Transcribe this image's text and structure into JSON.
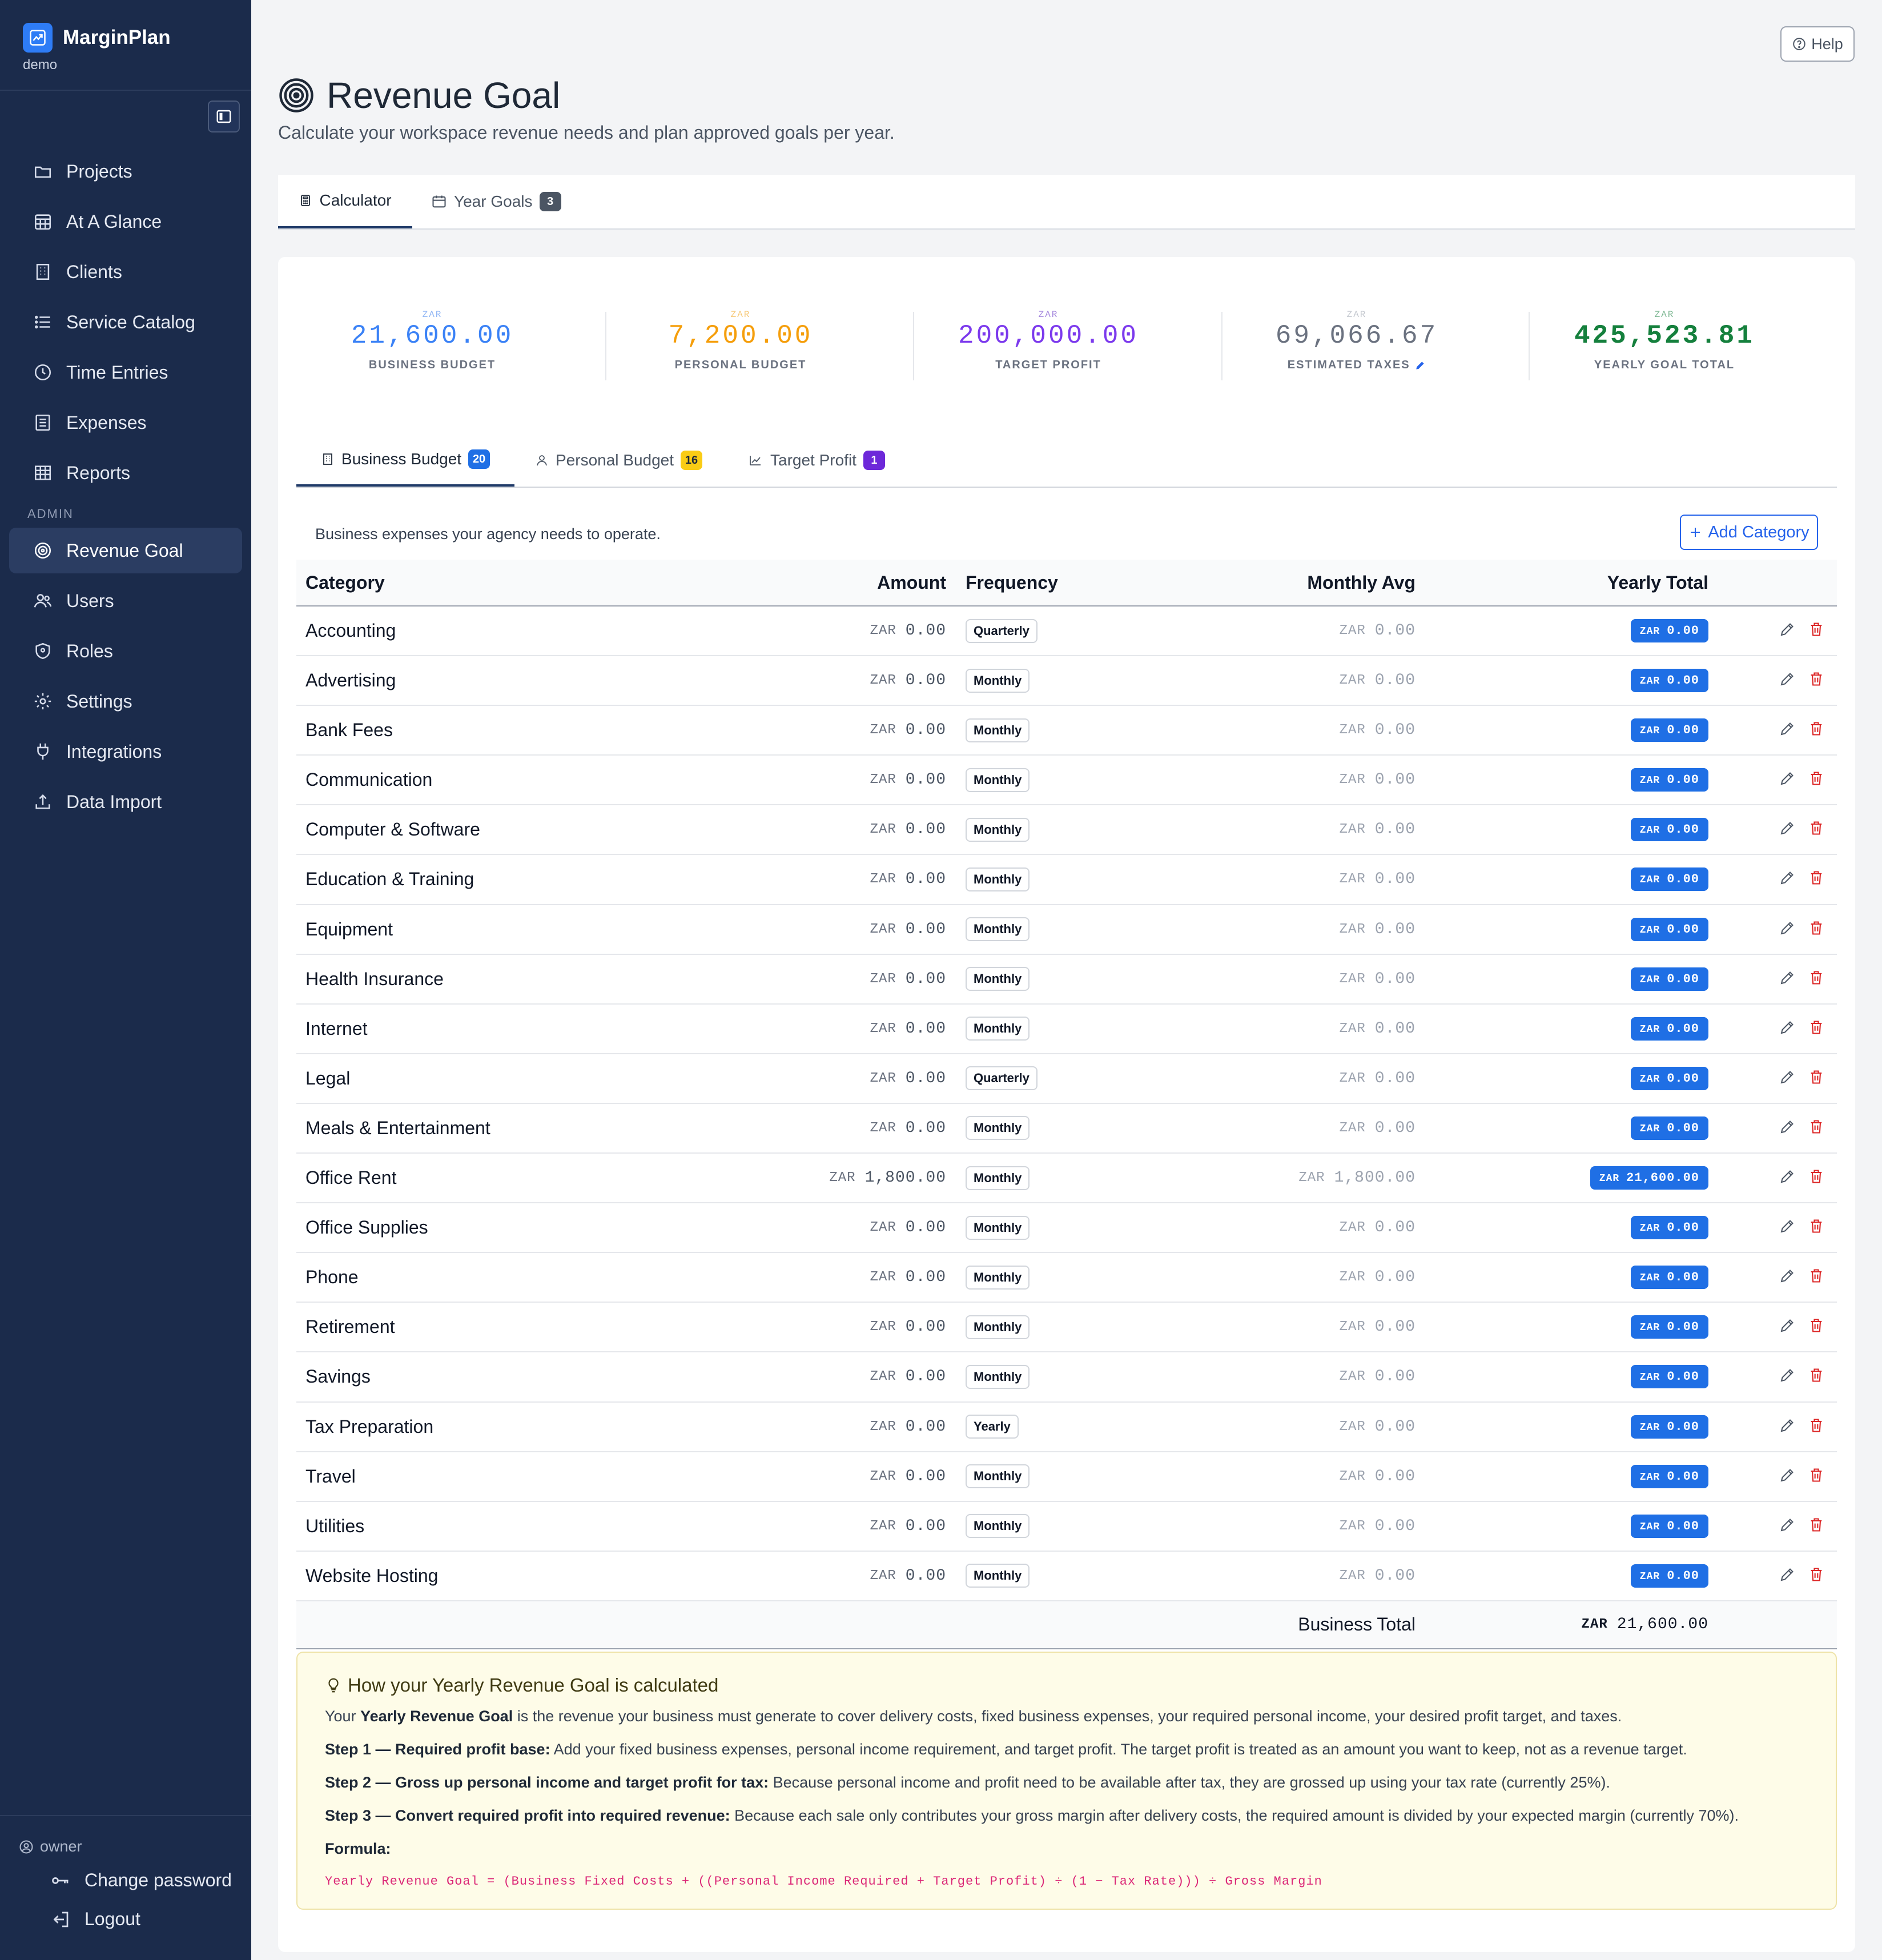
{
  "app": {
    "name": "MarginPlan",
    "workspace": "demo"
  },
  "sidebar": {
    "items": [
      {
        "label": "Projects",
        "icon": "folder-icon"
      },
      {
        "label": "At A Glance",
        "icon": "calendar-grid-icon"
      },
      {
        "label": "Clients",
        "icon": "building-icon"
      },
      {
        "label": "Service Catalog",
        "icon": "list-icon"
      },
      {
        "label": "Time Entries",
        "icon": "clock-icon"
      },
      {
        "label": "Expenses",
        "icon": "receipt-icon"
      },
      {
        "label": "Reports",
        "icon": "table-icon"
      }
    ],
    "admin_label": "ADMIN",
    "admin_items": [
      {
        "label": "Revenue Goal",
        "icon": "target-icon",
        "active": true
      },
      {
        "label": "Users",
        "icon": "users-icon"
      },
      {
        "label": "Roles",
        "icon": "shield-icon"
      },
      {
        "label": "Settings",
        "icon": "gear-icon"
      },
      {
        "label": "Integrations",
        "icon": "plug-icon"
      },
      {
        "label": "Data Import",
        "icon": "upload-icon"
      }
    ],
    "user_role": "owner",
    "change_password": "Change password",
    "logout": "Logout"
  },
  "header": {
    "help": "Help",
    "title": "Revenue Goal",
    "subtitle": "Calculate your workspace revenue needs and plan approved goals per year."
  },
  "top_tabs": [
    {
      "label": "Calculator",
      "active": true
    },
    {
      "label": "Year Goals",
      "count": "3"
    }
  ],
  "stats": [
    {
      "currency": "ZAR",
      "value": "21,600.00",
      "label": "BUSINESS BUDGET",
      "color": "#3b82f6"
    },
    {
      "currency": "ZAR",
      "value": "7,200.00",
      "label": "PERSONAL BUDGET",
      "color": "#f59e0b"
    },
    {
      "currency": "ZAR",
      "value": "200,000.00",
      "label": "TARGET PROFIT",
      "color": "#7c3aed"
    },
    {
      "currency": "ZAR",
      "value": "69,066.67",
      "label": "ESTIMATED TAXES",
      "color": "#6b7280"
    },
    {
      "currency": "ZAR",
      "value": "425,523.81",
      "label": "YEARLY GOAL TOTAL",
      "color": "#15803d"
    }
  ],
  "sub_tabs": [
    {
      "label": "Business Budget",
      "count": "20",
      "badge_color": "#1f6fe5",
      "active": true
    },
    {
      "label": "Personal Budget",
      "count": "16",
      "badge_color": "#facc15"
    },
    {
      "label": "Target Profit",
      "count": "1",
      "badge_color": "#6d28d9"
    }
  ],
  "business": {
    "description": "Business expenses your agency needs to operate.",
    "add_label": "Add Category",
    "columns": {
      "category": "Category",
      "amount": "Amount",
      "frequency": "Frequency",
      "monthly_avg": "Monthly Avg",
      "yearly_total": "Yearly Total"
    },
    "currency": "ZAR",
    "rows": [
      {
        "category": "Accounting",
        "amount": "0.00",
        "frequency": "Quarterly",
        "monthly": "0.00",
        "yearly": "0.00"
      },
      {
        "category": "Advertising",
        "amount": "0.00",
        "frequency": "Monthly",
        "monthly": "0.00",
        "yearly": "0.00"
      },
      {
        "category": "Bank Fees",
        "amount": "0.00",
        "frequency": "Monthly",
        "monthly": "0.00",
        "yearly": "0.00"
      },
      {
        "category": "Communication",
        "amount": "0.00",
        "frequency": "Monthly",
        "monthly": "0.00",
        "yearly": "0.00"
      },
      {
        "category": "Computer & Software",
        "amount": "0.00",
        "frequency": "Monthly",
        "monthly": "0.00",
        "yearly": "0.00"
      },
      {
        "category": "Education & Training",
        "amount": "0.00",
        "frequency": "Monthly",
        "monthly": "0.00",
        "yearly": "0.00"
      },
      {
        "category": "Equipment",
        "amount": "0.00",
        "frequency": "Monthly",
        "monthly": "0.00",
        "yearly": "0.00"
      },
      {
        "category": "Health Insurance",
        "amount": "0.00",
        "frequency": "Monthly",
        "monthly": "0.00",
        "yearly": "0.00"
      },
      {
        "category": "Internet",
        "amount": "0.00",
        "frequency": "Monthly",
        "monthly": "0.00",
        "yearly": "0.00"
      },
      {
        "category": "Legal",
        "amount": "0.00",
        "frequency": "Quarterly",
        "monthly": "0.00",
        "yearly": "0.00"
      },
      {
        "category": "Meals & Entertainment",
        "amount": "0.00",
        "frequency": "Monthly",
        "monthly": "0.00",
        "yearly": "0.00"
      },
      {
        "category": "Office Rent",
        "amount": "1,800.00",
        "frequency": "Monthly",
        "monthly": "1,800.00",
        "yearly": "21,600.00"
      },
      {
        "category": "Office Supplies",
        "amount": "0.00",
        "frequency": "Monthly",
        "monthly": "0.00",
        "yearly": "0.00"
      },
      {
        "category": "Phone",
        "amount": "0.00",
        "frequency": "Monthly",
        "monthly": "0.00",
        "yearly": "0.00"
      },
      {
        "category": "Retirement",
        "amount": "0.00",
        "frequency": "Monthly",
        "monthly": "0.00",
        "yearly": "0.00"
      },
      {
        "category": "Savings",
        "amount": "0.00",
        "frequency": "Monthly",
        "monthly": "0.00",
        "yearly": "0.00"
      },
      {
        "category": "Tax Preparation",
        "amount": "0.00",
        "frequency": "Yearly",
        "monthly": "0.00",
        "yearly": "0.00"
      },
      {
        "category": "Travel",
        "amount": "0.00",
        "frequency": "Monthly",
        "monthly": "0.00",
        "yearly": "0.00"
      },
      {
        "category": "Utilities",
        "amount": "0.00",
        "frequency": "Monthly",
        "monthly": "0.00",
        "yearly": "0.00"
      },
      {
        "category": "Website Hosting",
        "amount": "0.00",
        "frequency": "Monthly",
        "monthly": "0.00",
        "yearly": "0.00"
      }
    ],
    "total_label": "Business Total",
    "total_value": "21,600.00"
  },
  "info": {
    "title": "How your Yearly Revenue Goal is calculated",
    "intro_pre": "Your ",
    "intro_bold": "Yearly Revenue Goal",
    "intro_post": " is the revenue your business must generate to cover delivery costs, fixed business expenses, your required personal income, your desired profit target, and taxes.",
    "step1_bold": "Step 1 — Required profit base:",
    "step1_text": " Add your fixed business expenses, personal income requirement, and target profit. The target profit is treated as an amount you want to keep, not as a revenue target.",
    "step2_bold": "Step 2 — Gross up personal income and target profit for tax:",
    "step2_text": " Because personal income and profit need to be available after tax, they are grossed up using your tax rate (currently 25%).",
    "step3_bold": "Step 3 — Convert required profit into required revenue:",
    "step3_text": " Because each sale only contributes your gross margin after delivery costs, the required amount is divided by your expected margin (currently 70%).",
    "formula_label": "Formula:",
    "formula": "Yearly Revenue Goal = (Business Fixed Costs + ((Personal Income Required + Target Profit) ÷ (1 − Tax Rate))) ÷ Gross Margin"
  }
}
